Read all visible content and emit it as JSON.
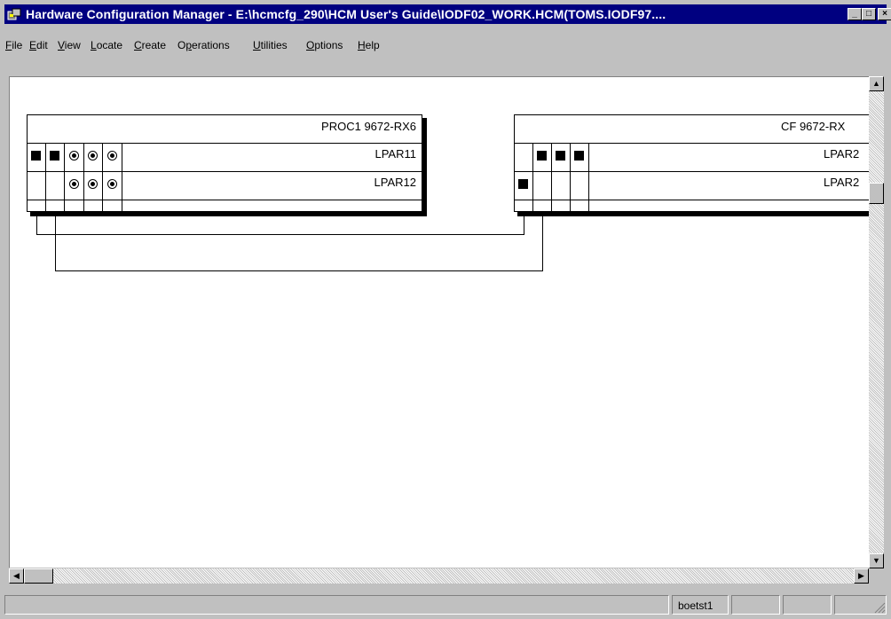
{
  "window": {
    "title": "Hardware Configuration Manager - E:\\hcmcfg_290\\HCM User's Guide\\IODF02_WORK.HCM(TOMS.IODF97....",
    "controls": [
      "_",
      "□",
      "×"
    ]
  },
  "menubar": {
    "items": [
      {
        "label": "File",
        "mnemonic": "F"
      },
      {
        "label": "Edit",
        "mnemonic": "E"
      },
      {
        "label": "View",
        "mnemonic": "V"
      },
      {
        "label": "Locate",
        "mnemonic": "L"
      },
      {
        "label": "Create",
        "mnemonic": "C"
      },
      {
        "label": "Operations",
        "mnemonic": "p"
      },
      {
        "label": "Utilities",
        "mnemonic": "U"
      },
      {
        "label": "Options",
        "mnemonic": "O"
      },
      {
        "label": "Help",
        "mnemonic": "H"
      }
    ]
  },
  "diagram": {
    "processors": [
      {
        "title": "PROC1 9672-RX6",
        "partitions": [
          {
            "name": "LPAR11",
            "cells": [
              "square",
              "square",
              "radio",
              "radio",
              "radio"
            ]
          },
          {
            "name": "LPAR12",
            "cells": [
              "empty",
              "empty",
              "radio",
              "radio",
              "radio"
            ]
          }
        ]
      },
      {
        "title": "CF 9672-RX",
        "partitions": [
          {
            "name": "LPAR2",
            "cells": [
              "empty",
              "square",
              "square",
              "square"
            ]
          },
          {
            "name": "LPAR2",
            "cells": [
              "square",
              "empty",
              "empty",
              "empty"
            ]
          }
        ]
      }
    ]
  },
  "scrollbars": {
    "up_arrow": "▲",
    "down_arrow": "▼",
    "left_arrow": "◀",
    "right_arrow": "▶"
  },
  "statusbar": {
    "panels": [
      "",
      "boetst1",
      "",
      "",
      ""
    ]
  },
  "colors": {
    "titlebar": "#000080",
    "face": "#c0c0c0",
    "canvas": "#ffffff"
  }
}
